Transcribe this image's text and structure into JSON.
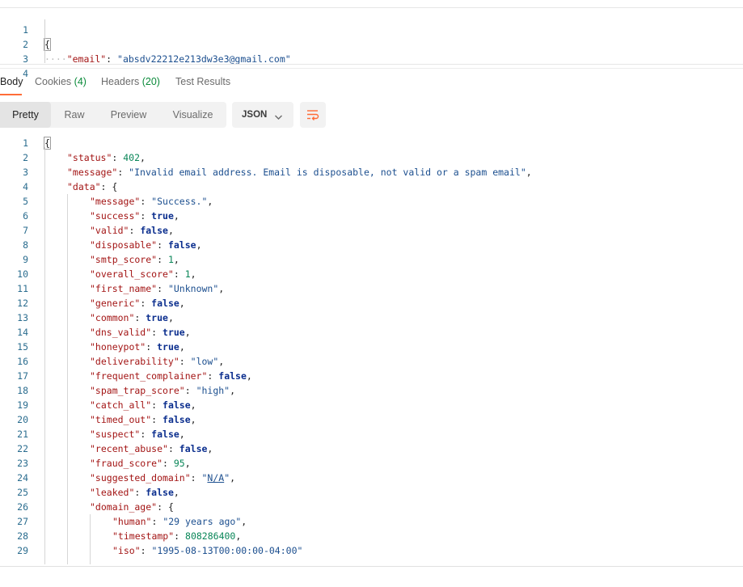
{
  "request_body": {
    "line_numbers": [
      "1",
      "2",
      "3",
      "4"
    ],
    "open_brace": "{",
    "indent_dots": "····",
    "email_key": "\"email\"",
    "colon": ": ",
    "email_value": "\"absdv22212e213dw3e3@gmail.com\""
  },
  "response_tabs": [
    {
      "label": "Body",
      "count": ""
    },
    {
      "label": "Cookies",
      "count": "(4)"
    },
    {
      "label": "Headers",
      "count": "(20)"
    },
    {
      "label": "Test Results",
      "count": ""
    }
  ],
  "view_modes": [
    "Pretty",
    "Raw",
    "Preview",
    "Visualize"
  ],
  "format_select": {
    "value": "JSON",
    "icon": "chevron-down-icon"
  },
  "wrap_button": {
    "icon": "wrap-lines-icon"
  },
  "response_lines": [
    {
      "num": "1",
      "indent": 0,
      "key": "",
      "open": "{"
    },
    {
      "num": "2",
      "indent": 1,
      "key": "\"status\"",
      "value": "402",
      "type": "n",
      "comma": ","
    },
    {
      "num": "3",
      "indent": 1,
      "key": "\"message\"",
      "value": "\"Invalid email address. Email is disposable, not valid or a spam email\"",
      "type": "s",
      "comma": ","
    },
    {
      "num": "4",
      "indent": 1,
      "key": "\"data\"",
      "open": "{"
    },
    {
      "num": "5",
      "indent": 2,
      "key": "\"message\"",
      "value": "\"Success.\"",
      "type": "s",
      "comma": ","
    },
    {
      "num": "6",
      "indent": 2,
      "key": "\"success\"",
      "value": "true",
      "type": "b",
      "comma": ","
    },
    {
      "num": "7",
      "indent": 2,
      "key": "\"valid\"",
      "value": "false",
      "type": "b",
      "comma": ","
    },
    {
      "num": "8",
      "indent": 2,
      "key": "\"disposable\"",
      "value": "false",
      "type": "b",
      "comma": ","
    },
    {
      "num": "9",
      "indent": 2,
      "key": "\"smtp_score\"",
      "value": "1",
      "type": "n",
      "comma": ","
    },
    {
      "num": "10",
      "indent": 2,
      "key": "\"overall_score\"",
      "value": "1",
      "type": "n",
      "comma": ","
    },
    {
      "num": "11",
      "indent": 2,
      "key": "\"first_name\"",
      "value": "\"Unknown\"",
      "type": "s",
      "comma": ","
    },
    {
      "num": "12",
      "indent": 2,
      "key": "\"generic\"",
      "value": "false",
      "type": "b",
      "comma": ","
    },
    {
      "num": "13",
      "indent": 2,
      "key": "\"common\"",
      "value": "true",
      "type": "b",
      "comma": ","
    },
    {
      "num": "14",
      "indent": 2,
      "key": "\"dns_valid\"",
      "value": "true",
      "type": "b",
      "comma": ","
    },
    {
      "num": "15",
      "indent": 2,
      "key": "\"honeypot\"",
      "value": "true",
      "type": "b",
      "comma": ","
    },
    {
      "num": "16",
      "indent": 2,
      "key": "\"deliverability\"",
      "value": "\"low\"",
      "type": "s",
      "comma": ","
    },
    {
      "num": "17",
      "indent": 2,
      "key": "\"frequent_complainer\"",
      "value": "false",
      "type": "b",
      "comma": ","
    },
    {
      "num": "18",
      "indent": 2,
      "key": "\"spam_trap_score\"",
      "value": "\"high\"",
      "type": "s",
      "comma": ","
    },
    {
      "num": "19",
      "indent": 2,
      "key": "\"catch_all\"",
      "value": "false",
      "type": "b",
      "comma": ","
    },
    {
      "num": "20",
      "indent": 2,
      "key": "\"timed_out\"",
      "value": "false",
      "type": "b",
      "comma": ","
    },
    {
      "num": "21",
      "indent": 2,
      "key": "\"suspect\"",
      "value": "false",
      "type": "b",
      "comma": ","
    },
    {
      "num": "22",
      "indent": 2,
      "key": "\"recent_abuse\"",
      "value": "false",
      "type": "b",
      "comma": ","
    },
    {
      "num": "23",
      "indent": 2,
      "key": "\"fraud_score\"",
      "value": "95",
      "type": "n",
      "comma": ","
    },
    {
      "num": "24",
      "indent": 2,
      "key": "\"suggested_domain\"",
      "value": "\"N/A\"",
      "type": "s",
      "comma": ","
    },
    {
      "num": "25",
      "indent": 2,
      "key": "\"leaked\"",
      "value": "false",
      "type": "b",
      "comma": ","
    },
    {
      "num": "26",
      "indent": 2,
      "key": "\"domain_age\"",
      "open": "{"
    },
    {
      "num": "27",
      "indent": 3,
      "key": "\"human\"",
      "value": "\"29 years ago\"",
      "type": "s",
      "comma": ","
    },
    {
      "num": "28",
      "indent": 3,
      "key": "\"timestamp\"",
      "value": "808286400",
      "type": "n",
      "comma": ","
    },
    {
      "num": "29",
      "indent": 3,
      "key": "\"iso\"",
      "value": "\"1995-08-13T00:00:00-04:00\"",
      "type": "s",
      "comma": ""
    }
  ]
}
